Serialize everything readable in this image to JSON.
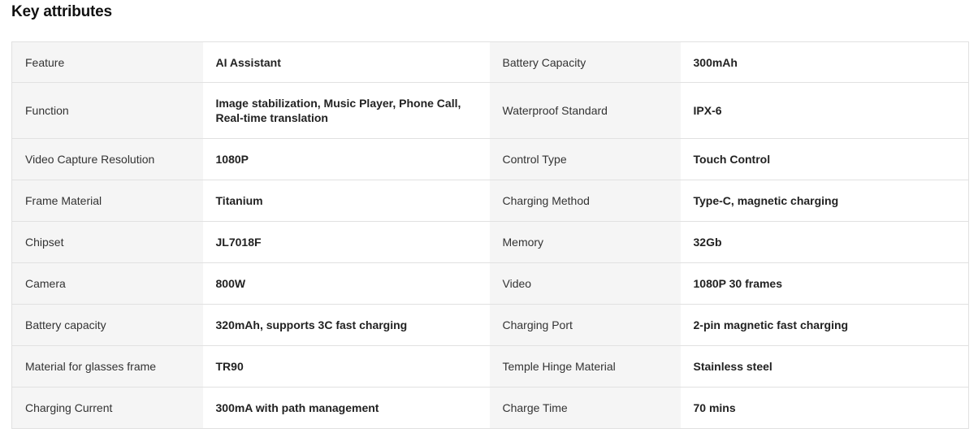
{
  "section_title": "Key attributes",
  "rows": [
    {
      "left_label": "Feature",
      "left_value": "AI Assistant",
      "right_label": "Battery Capacity",
      "right_value": "300mAh"
    },
    {
      "left_label": "Function",
      "left_value": "Image stabilization, Music Player, Phone Call, Real-time translation",
      "right_label": "Waterproof Standard",
      "right_value": "IPX-6"
    },
    {
      "left_label": "Video Capture Resolution",
      "left_value": "1080P",
      "right_label": "Control Type",
      "right_value": "Touch Control"
    },
    {
      "left_label": "Frame Material",
      "left_value": "Titanium",
      "right_label": "Charging Method",
      "right_value": "Type-C, magnetic charging"
    },
    {
      "left_label": "Chipset",
      "left_value": "JL7018F",
      "right_label": "Memory",
      "right_value": "32Gb"
    },
    {
      "left_label": "Camera",
      "left_value": "800W",
      "right_label": "Video",
      "right_value": "1080P 30 frames"
    },
    {
      "left_label": "Battery capacity",
      "left_value": "320mAh, supports 3C fast charging",
      "right_label": "Charging Port",
      "right_value": "2-pin magnetic fast charging"
    },
    {
      "left_label": "Material for glasses frame",
      "left_value": "TR90",
      "right_label": "Temple Hinge Material",
      "right_value": "Stainless steel"
    },
    {
      "left_label": "Charging Current",
      "left_value": "300mA with path management",
      "right_label": "Charge Time",
      "right_value": "70 mins"
    }
  ]
}
